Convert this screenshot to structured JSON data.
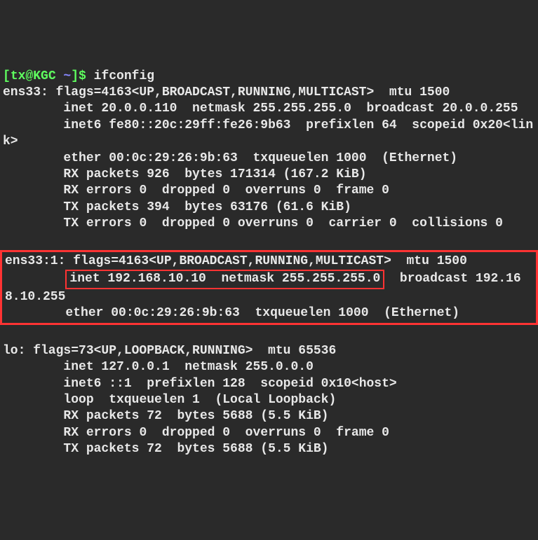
{
  "prompt": {
    "open_bracket": "[",
    "user": "tx@KGC",
    "path": " ~",
    "close_bracket": "]$ ",
    "command": "ifconfig"
  },
  "ens33": {
    "header": "ens33: flags=4163<UP,BROADCAST,RUNNING,MULTICAST>  mtu 1500",
    "inet": "        inet 20.0.0.110  netmask 255.255.255.0  broadcast 20.0.0.255",
    "inet6": "        inet6 fe80::20c:29ff:fe26:9b63  prefixlen 64  scopeid 0x20<link>",
    "ether": "        ether 00:0c:29:26:9b:63  txqueuelen 1000  (Ethernet)",
    "rx_packets": "        RX packets 926  bytes 171314 (167.2 KiB)",
    "rx_errors": "        RX errors 0  dropped 0  overruns 0  frame 0",
    "tx_packets": "        TX packets 394  bytes 63176 (61.6 KiB)",
    "tx_errors": "        TX errors 0  dropped 0 overruns 0  carrier 0  collisions 0"
  },
  "ens33_1": {
    "header": "ens33:1: flags=4163<UP,BROADCAST,RUNNING,MULTICAST>  mtu 1500",
    "inet_prefix": "        ",
    "inet_boxed": "inet 192.168.10.10  netmask 255.255.255.0",
    "inet_suffix": "  broadcast 192.168.10.255",
    "ether": "        ether 00:0c:29:26:9b:63  txqueuelen 1000  (Ethernet)"
  },
  "lo": {
    "header": "lo: flags=73<UP,LOOPBACK,RUNNING>  mtu 65536",
    "inet": "        inet 127.0.0.1  netmask 255.0.0.0",
    "inet6": "        inet6 ::1  prefixlen 128  scopeid 0x10<host>",
    "loop": "        loop  txqueuelen 1  (Local Loopback)",
    "rx_packets": "        RX packets 72  bytes 5688 (5.5 KiB)",
    "rx_errors": "        RX errors 0  dropped 0  overruns 0  frame 0",
    "tx_packets": "        TX packets 72  bytes 5688 (5.5 KiB)"
  },
  "blank": ""
}
